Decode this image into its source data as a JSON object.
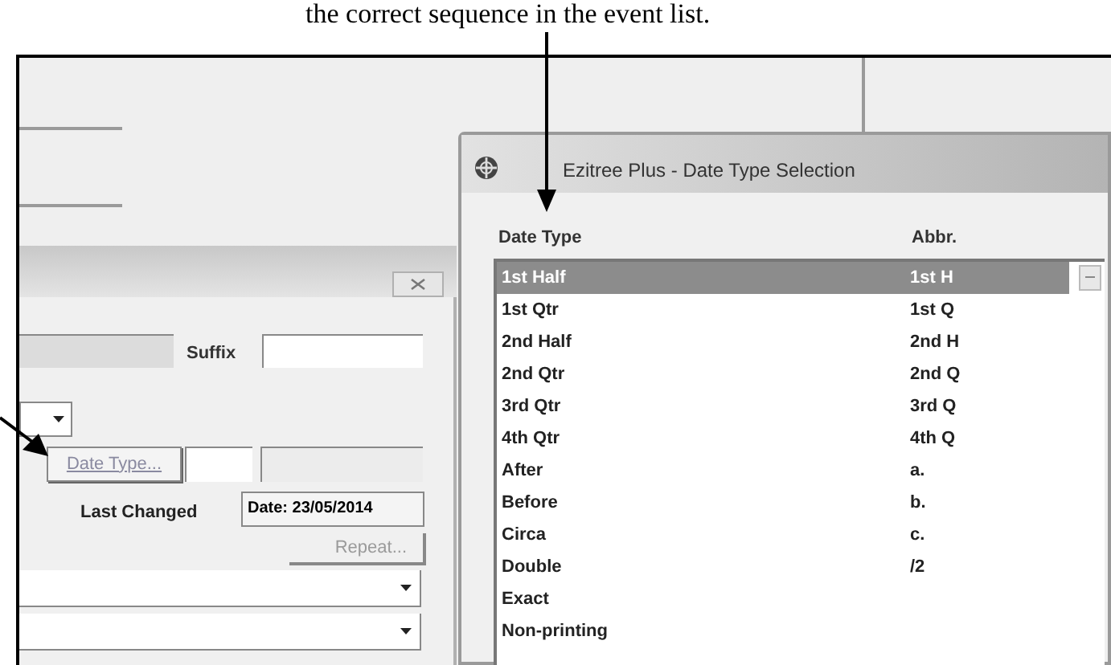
{
  "caption": "the correct sequence in the event list.",
  "record_panel": {
    "suffix_label": "Suffix",
    "date_type_button": {
      "label": "Date Type...",
      "disabled": true
    },
    "last_changed_label": "Last Changed",
    "last_changed_value": "Date: 23/05/2014",
    "repeat_button": {
      "label": "Repeat...",
      "disabled": true
    }
  },
  "dialog": {
    "title": "Ezitree Plus - Date Type Selection",
    "columns": [
      "Date Type",
      "Abbr."
    ],
    "rows": [
      {
        "date_type": "1st Half",
        "abbr": "1st H",
        "selected": true
      },
      {
        "date_type": "1st Qtr",
        "abbr": "1st Q",
        "selected": false
      },
      {
        "date_type": "2nd Half",
        "abbr": "2nd H",
        "selected": false
      },
      {
        "date_type": "2nd Qtr",
        "abbr": "2nd Q",
        "selected": false
      },
      {
        "date_type": "3rd Qtr",
        "abbr": "3rd Q",
        "selected": false
      },
      {
        "date_type": "4th Qtr",
        "abbr": "4th Q",
        "selected": false
      },
      {
        "date_type": "After",
        "abbr": "a.",
        "selected": false
      },
      {
        "date_type": "Before",
        "abbr": "b.",
        "selected": false
      },
      {
        "date_type": "Circa",
        "abbr": "c.",
        "selected": false
      },
      {
        "date_type": "Double",
        "abbr": "/2",
        "selected": false
      },
      {
        "date_type": "Exact",
        "selected": false
      },
      {
        "date_type": "Non-printing",
        "selected": false
      }
    ]
  }
}
